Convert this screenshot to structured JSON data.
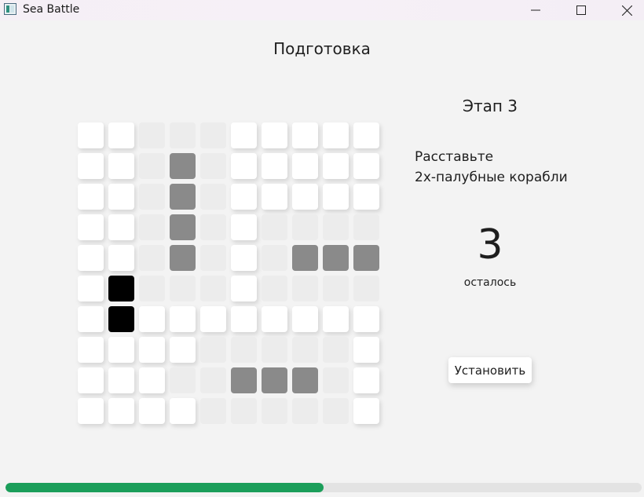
{
  "window": {
    "title": "Sea Battle",
    "controls": [
      "minimize-icon",
      "maximize-icon",
      "close-icon"
    ]
  },
  "page": {
    "title": "Подготовка"
  },
  "sidebar": {
    "stage": "Этап 3",
    "instruction_line1": "Расставьте",
    "instruction_line2": "2х-палубные корабли",
    "remaining_count": "3",
    "remaining_label": "осталось",
    "place_button_label": "Установить"
  },
  "board": {
    "rows": 10,
    "cols": 10,
    "legend": {
      "W": "free",
      "L": "blocked",
      "G": "placed-ship",
      "B": "current-ship"
    },
    "grid": [
      "WWLLLWWWWW",
      "WWLGLWWWWW",
      "WWLGLWWWWW",
      "WWLGLWLLLL",
      "WWLGLWLGGG",
      "WBLLLWLLLL",
      "WBWWWWWWWW",
      "WWWWLLLLLW",
      "WWWLLGGGLW",
      "WWWWLLLLLW"
    ]
  },
  "progress": {
    "fraction": 0.5
  },
  "colors": {
    "background": "#f3f3f3",
    "free_cell": "#ffffff",
    "blocked_cell": "#ececec",
    "placed_ship": "#8a8a8a",
    "current_ship": "#000000",
    "progress_fill": "#1b9e5a",
    "progress_track": "#e3e3e3"
  }
}
